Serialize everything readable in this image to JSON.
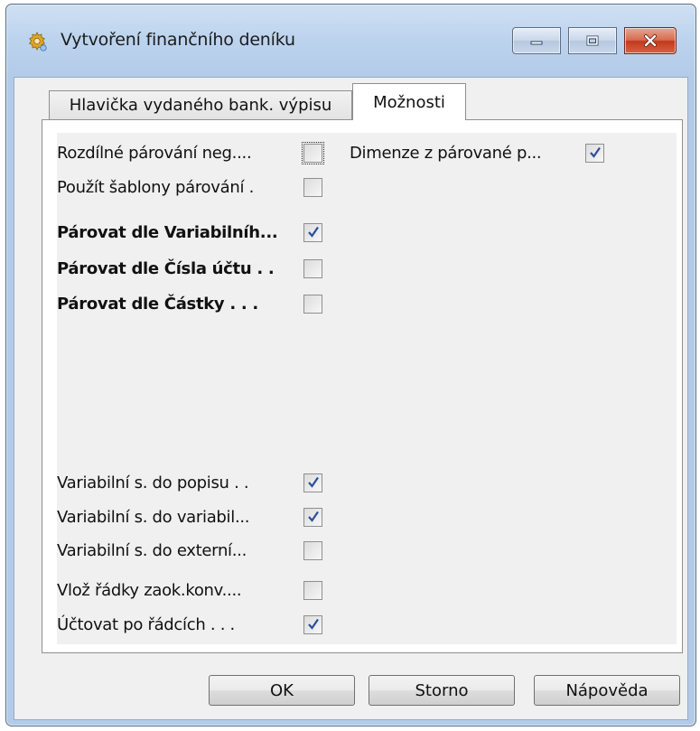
{
  "window": {
    "title": "Vytvoření finančního deníku",
    "icon": "gear-icon"
  },
  "tabs": [
    {
      "label": "Hlavička vydaného bank. výpisu",
      "active": false
    },
    {
      "label": "Možnosti",
      "active": true
    }
  ],
  "options": [
    {
      "label": "Rozdílné párování neg....",
      "checked": false,
      "bold": false,
      "focused": true
    },
    {
      "label": "Dimenze z párované p...",
      "checked": true,
      "bold": false
    },
    {
      "label": "Použít šablony párování .",
      "checked": false,
      "bold": false
    },
    {
      "label": "Párovat dle Variabilníh...",
      "checked": true,
      "bold": true
    },
    {
      "label": "Párovat dle Čísla účtu . .",
      "checked": false,
      "bold": true
    },
    {
      "label": "Párovat dle Částky . . .",
      "checked": false,
      "bold": true
    },
    {
      "label": "Variabilní s. do popisu . .",
      "checked": true,
      "bold": false
    },
    {
      "label": "Variabilní s. do variabil...",
      "checked": true,
      "bold": false
    },
    {
      "label": "Variabilní s. do externí...",
      "checked": false,
      "bold": false
    },
    {
      "label": "Vlož řádky zaok.konv....",
      "checked": false,
      "bold": false
    },
    {
      "label": "Účtovat po řádcích . . .",
      "checked": true,
      "bold": false
    }
  ],
  "buttons": {
    "ok": "OK",
    "cancel": "Storno",
    "help": "Nápověda"
  },
  "colors": {
    "title_bar": "#b2cbe8",
    "close_button": "#c2391d",
    "check_mark": "#2a4d9c"
  }
}
